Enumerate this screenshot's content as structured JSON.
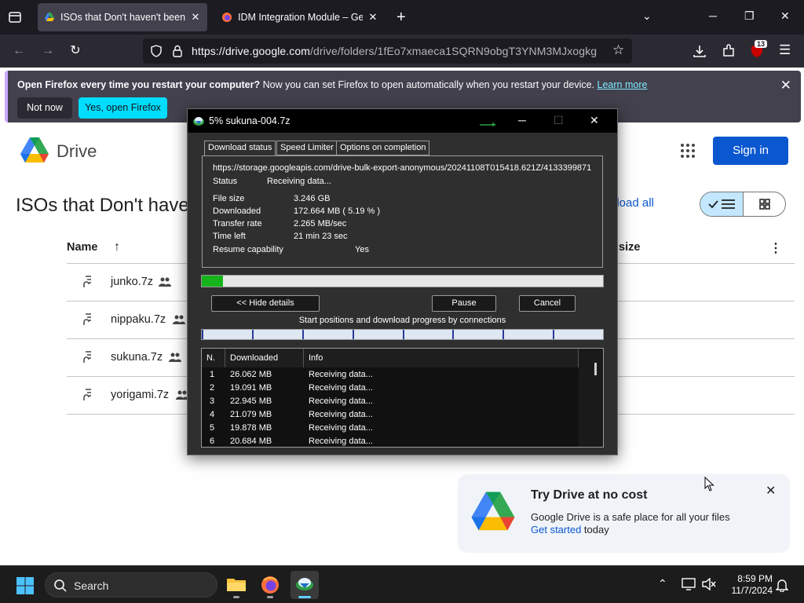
{
  "browser": {
    "tabs": [
      {
        "title": "ISOs that Don't haven't been up",
        "active": true
      },
      {
        "title": "IDM Integration Module – Get t",
        "active": false
      }
    ],
    "url_host": "https://drive.google.com",
    "url_path": "/drive/folders/1fEo7xmaeca1SQRN9obgT3YNM3MJxogkg",
    "extension_badge": "13",
    "notification": {
      "bold": "Open Firefox every time you restart your computer?",
      "text": " Now you can set Firefox to open automatically when you restart your device.",
      "link": "Learn more",
      "not_now": "Not now",
      "yes": "Yes, open Firefox"
    }
  },
  "drive": {
    "brand": "Drive",
    "sign_in": "Sign in",
    "folder_title": "ISOs that Don't have",
    "download_all": "nload all",
    "col_name": "Name",
    "col_size": "size",
    "files": [
      {
        "name": "junko.7z"
      },
      {
        "name": "nippaku.7z"
      },
      {
        "name": "sukuna.7z"
      },
      {
        "name": "yorigami.7z"
      }
    ],
    "promo": {
      "title": "Try Drive at no cost",
      "text": "Google Drive is a safe place for all your files",
      "link": "Get started",
      "link_suffix": " today"
    }
  },
  "idm": {
    "title": "5% sukuna-004.7z",
    "tabs": [
      "Download status",
      "Speed Limiter",
      "Options on completion"
    ],
    "url": "https://storage.googleapis.com/drive-bulk-export-anonymous/20241108T015418.621Z/4133399871",
    "status_label": "Status",
    "status_value": "Receiving data...",
    "file_size_label": "File size",
    "file_size_value": "3.246  GB",
    "downloaded_label": "Downloaded",
    "downloaded_value": "172.664  MB  ( 5.19 % )",
    "transfer_rate_label": "Transfer rate",
    "transfer_rate_value": "2.265  MB/sec",
    "time_left_label": "Time left",
    "time_left_value": "21 min 23 sec",
    "resume_label": "Resume capability",
    "resume_value": "Yes",
    "progress_fraction": 0.0519,
    "hide_details": "<< Hide details",
    "pause": "Pause",
    "cancel": "Cancel",
    "connections_label": "Start positions and download progress by connections",
    "table_headers": [
      "N.",
      "Downloaded",
      "Info"
    ],
    "connections": [
      {
        "n": "1",
        "downloaded": "26.062  MB",
        "info": "Receiving data..."
      },
      {
        "n": "2",
        "downloaded": "19.091  MB",
        "info": "Receiving data..."
      },
      {
        "n": "3",
        "downloaded": "22.945  MB",
        "info": "Receiving data..."
      },
      {
        "n": "4",
        "downloaded": "21.079  MB",
        "info": "Receiving data..."
      },
      {
        "n": "5",
        "downloaded": "19.878  MB",
        "info": "Receiving data..."
      },
      {
        "n": "6",
        "downloaded": "20.684  MB",
        "info": "Receiving data..."
      }
    ]
  },
  "taskbar": {
    "search_placeholder": "Search",
    "time": "8:59 PM",
    "date": "11/7/2024"
  },
  "colors": {
    "firefox_dark": "#1c1b22",
    "accent_cyan": "#00ddff",
    "drive_blue": "#0b57d0",
    "idm_progress_green": "#17b31b"
  }
}
